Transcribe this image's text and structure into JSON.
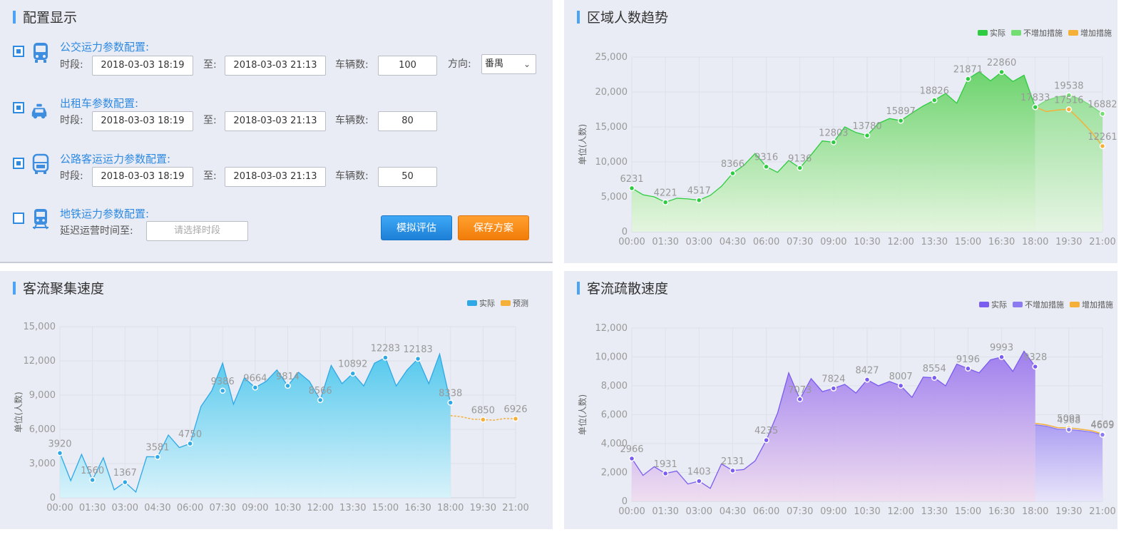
{
  "config_panel": {
    "title": "配置显示",
    "sections": [
      {
        "checked": true,
        "icon": "bus-icon",
        "title": "公交运力参数配置:",
        "period_label": "时段:",
        "start": "2018-03-03 18:19",
        "to_label": "至:",
        "end": "2018-03-03 21:13",
        "count_label": "车辆数:",
        "count": "100",
        "direction_label": "方向:",
        "direction": "番禺"
      },
      {
        "checked": true,
        "icon": "taxi-icon",
        "title": "出租车参数配置:",
        "period_label": "时段:",
        "start": "2018-03-03 18:19",
        "to_label": "至:",
        "end": "2018-03-03 21:13",
        "count_label": "车辆数:",
        "count": "80"
      },
      {
        "checked": true,
        "icon": "coach-icon",
        "title": "公路客运运力参数配置:",
        "period_label": "时段:",
        "start": "2018-03-03 18:19",
        "to_label": "至:",
        "end": "2018-03-03 21:13",
        "count_label": "车辆数:",
        "count": "50"
      },
      {
        "checked": false,
        "icon": "metro-icon",
        "title": "地铁运力参数配置:",
        "delay_label": "延迟运营时间至:",
        "delay_placeholder": "请选择时段"
      }
    ],
    "simulate_button": "模拟评估",
    "save_button": "保存方案"
  },
  "chart_data": [
    {
      "type": "area",
      "title": "区域人数趋势",
      "ylabel": "单位(人数)",
      "ylim": [
        0,
        25000
      ],
      "yticks": [
        "0",
        "5,000",
        "10,000",
        "15,000",
        "20,000",
        "25,000"
      ],
      "xticks": [
        "00:00",
        "01:30",
        "03:00",
        "04:30",
        "06:00",
        "07:30",
        "09:00",
        "10:30",
        "12:00",
        "13:30",
        "15:00",
        "16:30",
        "18:00",
        "19:30",
        "21:00"
      ],
      "legend": [
        {
          "name": "实际",
          "color": "#2ecc40"
        },
        {
          "name": "不增加措施",
          "color": "#74dd74"
        },
        {
          "name": "增加措施",
          "color": "#f5b03a"
        }
      ],
      "series": [
        {
          "name": "实际",
          "x": [
            "00:00",
            "00:30",
            "01:00",
            "01:30",
            "02:00",
            "02:30",
            "03:00",
            "03:30",
            "04:00",
            "04:30",
            "05:00",
            "05:30",
            "06:00",
            "06:30",
            "07:00",
            "07:30",
            "08:00",
            "08:30",
            "09:00",
            "09:30",
            "10:00",
            "10:30",
            "11:00",
            "11:30",
            "12:00",
            "12:30",
            "13:00",
            "13:30",
            "14:00",
            "14:30",
            "15:00",
            "15:30",
            "16:00",
            "16:30",
            "17:00",
            "17:30",
            "18:00"
          ],
          "values": [
            6231,
            5300,
            5000,
            4221,
            4800,
            4700,
            4517,
            5200,
            6500,
            8366,
            9500,
            11200,
            9316,
            8500,
            10200,
            9136,
            11000,
            13000,
            12803,
            15000,
            14200,
            13780,
            15500,
            16200,
            15897,
            17000,
            18000,
            18826,
            19800,
            18400,
            21871,
            22900,
            21600,
            22860,
            21500,
            22400,
            17833
          ]
        },
        {
          "name": "不增加措施",
          "x": [
            "18:00",
            "18:30",
            "19:00",
            "19:30",
            "20:00",
            "20:30",
            "21:00"
          ],
          "values": [
            17833,
            18800,
            19300,
            19538,
            19000,
            18000,
            16882
          ]
        },
        {
          "name": "增加措施",
          "x": [
            "18:00",
            "18:30",
            "19:00",
            "19:30",
            "20:00",
            "20:30",
            "21:00"
          ],
          "values": [
            17833,
            17200,
            17416,
            17516,
            16000,
            14300,
            12261
          ]
        }
      ],
      "data_labels": [
        {
          "x": "00:00",
          "value": "6231"
        },
        {
          "x": "01:30",
          "value": "4221"
        },
        {
          "x": "03:00",
          "value": "4517"
        },
        {
          "x": "04:30",
          "value": "8366"
        },
        {
          "x": "06:00",
          "value": "9316"
        },
        {
          "x": "07:30",
          "value": "9136"
        },
        {
          "x": "09:00",
          "value": "12803"
        },
        {
          "x": "10:30",
          "value": "13780"
        },
        {
          "x": "12:00",
          "value": "15897"
        },
        {
          "x": "13:30",
          "value": "18826"
        },
        {
          "x": "15:00",
          "value": "21871"
        },
        {
          "x": "16:30",
          "value": "22860"
        },
        {
          "x": "18:00",
          "value": "17833"
        },
        {
          "x": "19:30",
          "value": "19538"
        },
        {
          "x": "19:30",
          "value": "17516"
        },
        {
          "x": "21:00",
          "value": "16882"
        },
        {
          "x": "21:00",
          "value": "12261"
        }
      ]
    },
    {
      "type": "area",
      "title": "客流聚集速度",
      "ylabel": "单位(人数)",
      "ylim": [
        0,
        15000
      ],
      "yticks": [
        "0",
        "3,000",
        "6,000",
        "9,000",
        "12,000",
        "15,000"
      ],
      "xticks": [
        "00:00",
        "01:30",
        "03:00",
        "04:30",
        "06:00",
        "07:30",
        "09:00",
        "10:30",
        "12:00",
        "13:30",
        "15:00",
        "16:30",
        "18:00",
        "19:30",
        "21:00"
      ],
      "legend": [
        {
          "name": "实际",
          "color": "#2fa8e6"
        },
        {
          "name": "预测",
          "color": "#f5b03a"
        }
      ],
      "series": [
        {
          "name": "实际",
          "x": [
            "00:00",
            "00:30",
            "01:00",
            "01:30",
            "02:00",
            "02:30",
            "03:00",
            "03:30",
            "04:00",
            "04:30",
            "05:00",
            "05:30",
            "06:00",
            "06:30",
            "07:00",
            "07:30",
            "08:00",
            "08:30",
            "09:00",
            "09:30",
            "10:00",
            "10:30",
            "11:00",
            "11:30",
            "12:00",
            "12:30",
            "13:00",
            "13:30",
            "14:00",
            "14:30",
            "15:00",
            "15:30",
            "16:00",
            "16:30",
            "17:00",
            "17:30",
            "18:00"
          ],
          "values": [
            3920,
            1500,
            3800,
            1560,
            3500,
            700,
            1367,
            500,
            3600,
            3581,
            5500,
            4400,
            4750,
            8000,
            9386,
            11800,
            8200,
            10500,
            9664,
            10200,
            11200,
            9814,
            11000,
            10200,
            8566,
            11600,
            10000,
            10892,
            9800,
            11800,
            12283,
            9800,
            11200,
            12183,
            10000,
            12600,
            8338
          ]
        },
        {
          "name": "预测",
          "x": [
            "18:00",
            "18:30",
            "19:00",
            "19:30",
            "20:00",
            "20:30",
            "21:00"
          ],
          "values": [
            7200,
            7100,
            6900,
            6850,
            6800,
            6950,
            6926
          ]
        }
      ],
      "data_labels": [
        {
          "x": "00:00",
          "value": "3920"
        },
        {
          "x": "01:30",
          "value": "1560"
        },
        {
          "x": "03:00",
          "value": "1367"
        },
        {
          "x": "04:30",
          "value": "3581"
        },
        {
          "x": "06:00",
          "value": "4750"
        },
        {
          "x": "07:30",
          "value": "9386"
        },
        {
          "x": "09:00",
          "value": "9664"
        },
        {
          "x": "10:30",
          "value": "9814"
        },
        {
          "x": "12:00",
          "value": "8566"
        },
        {
          "x": "13:30",
          "value": "10892"
        },
        {
          "x": "15:00",
          "value": "12283"
        },
        {
          "x": "16:30",
          "value": "12183"
        },
        {
          "x": "18:00",
          "value": "8338"
        },
        {
          "x": "19:30",
          "value": "6850"
        },
        {
          "x": "21:00",
          "value": "6926"
        }
      ]
    },
    {
      "type": "area",
      "title": "客流疏散速度",
      "ylabel": "单位(人数)",
      "ylim": [
        0,
        12000
      ],
      "yticks": [
        "0",
        "2,000",
        "4,000",
        "6,000",
        "8,000",
        "10,000",
        "12,000"
      ],
      "xticks": [
        "00:00",
        "01:30",
        "03:00",
        "04:30",
        "06:00",
        "07:30",
        "09:00",
        "10:30",
        "12:00",
        "13:30",
        "15:00",
        "16:30",
        "18:00",
        "19:30",
        "21:00"
      ],
      "legend": [
        {
          "name": "实际",
          "color": "#7b5cf0"
        },
        {
          "name": "不增加措施",
          "color": "#8c7af0"
        },
        {
          "name": "增加措施",
          "color": "#f5b03a"
        }
      ],
      "series": [
        {
          "name": "实际",
          "x": [
            "00:00",
            "00:30",
            "01:00",
            "01:30",
            "02:00",
            "02:30",
            "03:00",
            "03:30",
            "04:00",
            "04:30",
            "05:00",
            "05:30",
            "06:00",
            "06:30",
            "07:00",
            "07:30",
            "08:00",
            "08:30",
            "09:00",
            "09:30",
            "10:00",
            "10:30",
            "11:00",
            "11:30",
            "12:00",
            "12:30",
            "13:00",
            "13:30",
            "14:00",
            "14:30",
            "15:00",
            "15:30",
            "16:00",
            "16:30",
            "17:00",
            "17:30",
            "18:00"
          ],
          "values": [
            2966,
            1800,
            2400,
            1931,
            2100,
            1200,
            1403,
            900,
            2600,
            2131,
            2200,
            2800,
            4235,
            6100,
            8900,
            7073,
            8500,
            7600,
            7824,
            8100,
            7500,
            8427,
            8000,
            8300,
            8007,
            7200,
            8600,
            8554,
            8000,
            9500,
            9196,
            8900,
            9800,
            9993,
            9000,
            10400,
            9328
          ]
        },
        {
          "name": "不增加措施",
          "x": [
            "18:00",
            "18:30",
            "19:00",
            "19:30",
            "20:00",
            "20:30",
            "21:00"
          ],
          "values": [
            5300,
            5200,
            5000,
            4968,
            4900,
            4800,
            4609
          ]
        },
        {
          "name": "增加措施",
          "x": [
            "18:00",
            "18:30",
            "19:00",
            "19:30",
            "20:00",
            "20:30",
            "21:00"
          ],
          "values": [
            5400,
            5300,
            5100,
            5093,
            5000,
            4900,
            4669
          ]
        }
      ],
      "data_labels": [
        {
          "x": "00:00",
          "value": "2966"
        },
        {
          "x": "01:30",
          "value": "1931"
        },
        {
          "x": "03:00",
          "value": "1403"
        },
        {
          "x": "04:30",
          "value": "2131"
        },
        {
          "x": "06:00",
          "value": "4235"
        },
        {
          "x": "07:30",
          "value": "7073"
        },
        {
          "x": "09:00",
          "value": "7824"
        },
        {
          "x": "10:30",
          "value": "8427"
        },
        {
          "x": "12:00",
          "value": "8007"
        },
        {
          "x": "13:30",
          "value": "8554"
        },
        {
          "x": "15:00",
          "value": "9196"
        },
        {
          "x": "16:30",
          "value": "9993"
        },
        {
          "x": "18:00",
          "value": "9328"
        },
        {
          "x": "19:30",
          "value": "5093"
        },
        {
          "x": "19:30",
          "value": "4968"
        },
        {
          "x": "21:00",
          "value": "4669"
        },
        {
          "x": "21:00",
          "value": "4609"
        }
      ]
    }
  ]
}
